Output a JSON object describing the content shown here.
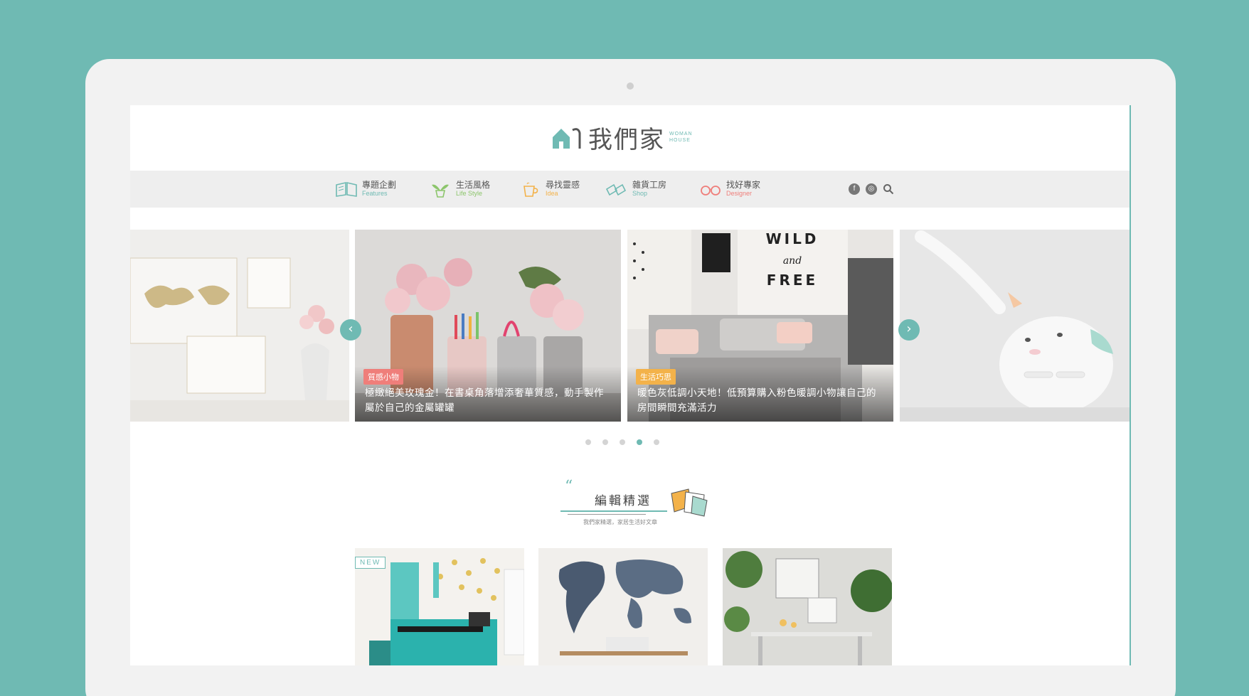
{
  "site": {
    "logo_text": "我們家",
    "logo_sub": "WOMAN HOUSE"
  },
  "nav": {
    "items": [
      {
        "zh": "專題企劃",
        "en": "Features",
        "icon": "book-icon",
        "color": "#6fbab3"
      },
      {
        "zh": "生活風格",
        "en": "Life Style",
        "icon": "plant-icon",
        "color": "#8cc56b"
      },
      {
        "zh": "尋找靈感",
        "en": "Idea",
        "icon": "cup-icon",
        "color": "#f3b24a"
      },
      {
        "zh": "雜貨工房",
        "en": "Shop",
        "icon": "shoes-icon",
        "color": "#6fbab3"
      },
      {
        "zh": "找好專家",
        "en": "Designer",
        "icon": "glasses-icon",
        "color": "#ef7e7a"
      }
    ],
    "social": {
      "facebook": "f",
      "instagram": "◎"
    }
  },
  "slider": {
    "slides": [
      {
        "tag": "",
        "caption": ""
      },
      {
        "tag": "質感小物",
        "tag_color": "#ef7e7a",
        "caption": "極緻絕美玫瑰金！在書桌角落增添奢華質感，動手製作屬於自己的金屬罐罐"
      },
      {
        "tag": "生活巧思",
        "tag_color": "#f3b24a",
        "caption": "暖色灰低調小天地！低預算購入粉色暖調小物讓自己的房間瞬間充滿活力"
      },
      {
        "tag": "",
        "caption": ""
      }
    ],
    "prev": "‹",
    "next": "›",
    "dots": 5,
    "active_dot": 3
  },
  "editor": {
    "quote": "“",
    "title": "編輯精選",
    "subtitle": "我們家精選，家居生活好文章"
  },
  "cards": [
    {
      "badge": "NEW"
    },
    {
      "badge": ""
    },
    {
      "badge": ""
    }
  ]
}
